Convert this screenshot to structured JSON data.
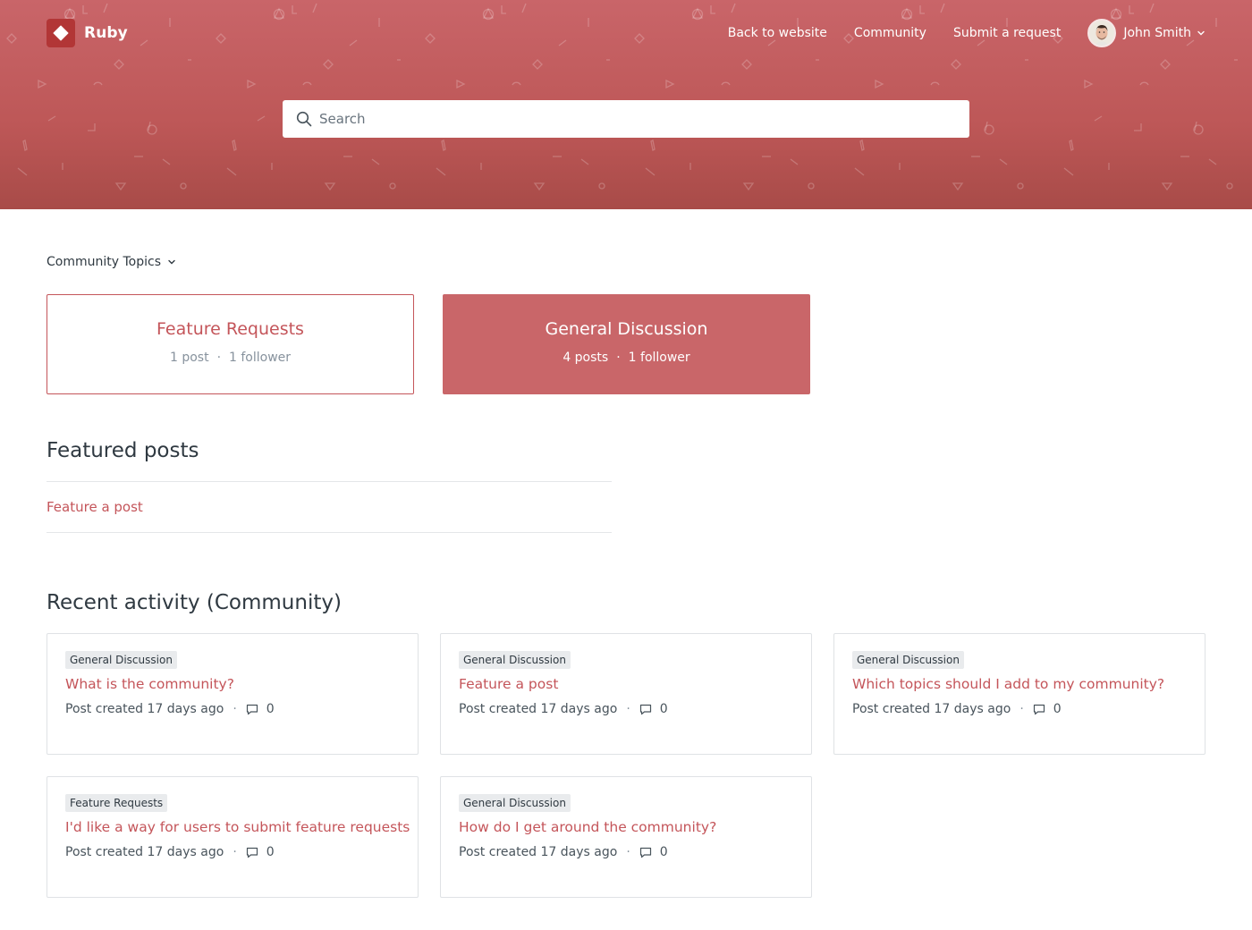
{
  "brand": {
    "name": "Ruby",
    "logo_icon": "diamond-logo-icon"
  },
  "nav": {
    "links": [
      "Back to website",
      "Community",
      "Submit a request"
    ],
    "user_name": "John Smith"
  },
  "search": {
    "placeholder": "Search"
  },
  "topics_dropdown": {
    "label": "Community Topics"
  },
  "topics": [
    {
      "title": "Feature Requests",
      "posts": "1 post",
      "followers": "1 follower",
      "active": false
    },
    {
      "title": "General Discussion",
      "posts": "4 posts",
      "followers": "1 follower",
      "active": true
    }
  ],
  "featured": {
    "heading": "Featured posts",
    "link": "Feature a post"
  },
  "recent": {
    "heading": "Recent activity (Community)",
    "posts": [
      {
        "topic": "General Discussion",
        "title": "What is the community?",
        "meta": "Post created 17 days ago",
        "comments": "0"
      },
      {
        "topic": "General Discussion",
        "title": "Feature a post",
        "meta": "Post created 17 days ago",
        "comments": "0"
      },
      {
        "topic": "General Discussion",
        "title": "Which topics should I add to my community?",
        "meta": "Post created 17 days ago",
        "comments": "0"
      },
      {
        "topic": "Feature Requests",
        "title": "I'd like a way for users to submit feature requests",
        "meta": "Post created 17 days ago",
        "comments": "0"
      },
      {
        "topic": "General Discussion",
        "title": "How do I get around the community?",
        "meta": "Post created 17 days ago",
        "comments": "0"
      }
    ]
  },
  "colors": {
    "brand": "#c4555a",
    "hero_top": "#c96569",
    "hero_bottom": "#a84b48",
    "active_topic": "#c96669"
  }
}
